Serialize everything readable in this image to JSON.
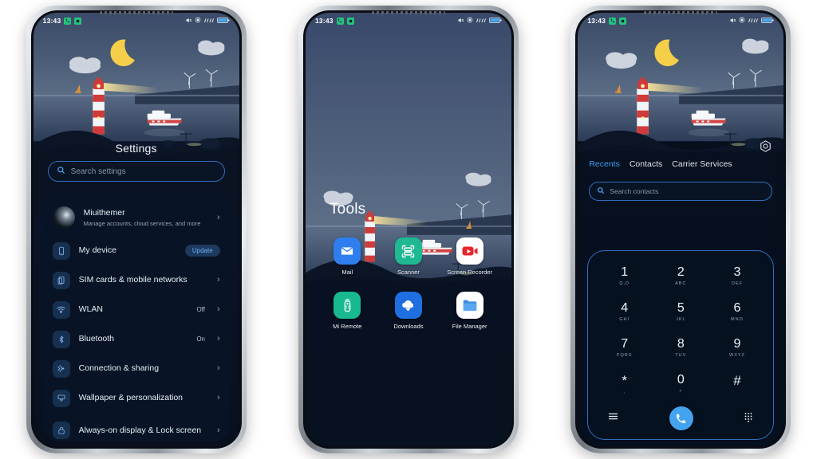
{
  "meta": {
    "background_color": "#ffffff",
    "theme_accent": "#3f9bf0"
  },
  "status_bar": {
    "time": "13:43",
    "left_icons": [
      "phone-call-active-icon",
      "screen-recording-icon"
    ],
    "right_icons": [
      "mute-icon",
      "dnd-icon",
      "signal-bars-icon",
      "battery-icon"
    ]
  },
  "phone1": {
    "title": "Settings",
    "search": {
      "placeholder": "Search settings",
      "icon": "search-icon"
    },
    "items": [
      {
        "label": "Miuithemer",
        "sub": "Manage accounts, cloud services, and more",
        "icon": "account-avatar",
        "value": "",
        "chevron": "›"
      },
      {
        "label": "My device",
        "sub": "",
        "icon": "device-icon",
        "badge": "Update",
        "chevron": ""
      },
      {
        "label": "SIM cards & mobile networks",
        "sub": "",
        "icon": "sim-card-icon",
        "value": "",
        "chevron": "›"
      },
      {
        "label": "WLAN",
        "sub": "",
        "icon": "wifi-icon",
        "value": "Off",
        "chevron": "›"
      },
      {
        "label": "Bluetooth",
        "sub": "",
        "icon": "bluetooth-icon",
        "value": "On",
        "chevron": "›"
      },
      {
        "label": "Connection & sharing",
        "sub": "",
        "icon": "connection-sharing-icon",
        "value": "",
        "chevron": "›"
      },
      {
        "label": "Wallpaper & personalization",
        "sub": "",
        "icon": "wallpaper-brush-icon",
        "value": "",
        "chevron": "›"
      },
      {
        "label": "Always-on display & Lock screen",
        "sub": "",
        "icon": "lock-icon",
        "value": "",
        "chevron": "›"
      }
    ]
  },
  "phone2": {
    "folder_title": "Tools",
    "apps": [
      {
        "label": "Mail",
        "icon": "mail-icon"
      },
      {
        "label": "Scanner",
        "icon": "scanner-icon"
      },
      {
        "label": "Screen Recorder",
        "icon": "screen-recorder-icon"
      },
      {
        "label": "Mi Remote",
        "icon": "remote-control-icon"
      },
      {
        "label": "Downloads",
        "icon": "download-cloud-icon"
      },
      {
        "label": "File Manager",
        "icon": "folder-icon"
      }
    ]
  },
  "phone3": {
    "settings_icon": "hex-gear-icon",
    "tabs": [
      {
        "label": "Recents",
        "active": true
      },
      {
        "label": "Contacts",
        "active": false
      },
      {
        "label": "Carrier Services",
        "active": false
      }
    ],
    "search": {
      "placeholder": "Search contacts",
      "icon": "search-icon"
    },
    "keypad": [
      {
        "digit": "1",
        "sub": "Q,D"
      },
      {
        "digit": "2",
        "sub": "ABC"
      },
      {
        "digit": "3",
        "sub": "DEF"
      },
      {
        "digit": "4",
        "sub": "GHI"
      },
      {
        "digit": "5",
        "sub": "JKL"
      },
      {
        "digit": "6",
        "sub": "MNO"
      },
      {
        "digit": "7",
        "sub": "PQRS"
      },
      {
        "digit": "8",
        "sub": "TUV"
      },
      {
        "digit": "9",
        "sub": "WXYZ"
      },
      {
        "digit": "*",
        "sub": ","
      },
      {
        "digit": "0",
        "sub": "+"
      },
      {
        "digit": "#",
        "sub": ""
      }
    ],
    "bottom_bar": {
      "left_icon": "menu-lines-icon",
      "call_icon": "phone-handset-icon",
      "right_icon": "dialpad-icon"
    }
  }
}
